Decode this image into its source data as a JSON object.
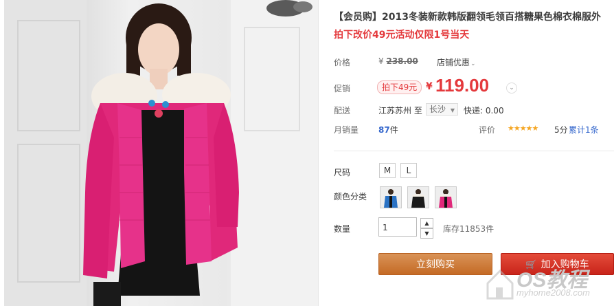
{
  "product": {
    "title": "【会员购】2013冬装新款韩版翻领毛领百搭糖果色棉衣棉服外",
    "subtitle": "拍下改价49元活动仅限1号当天"
  },
  "price": {
    "label": "价格",
    "currency": "¥",
    "original": "238.00",
    "shop_discount": "店铺优惠"
  },
  "promo": {
    "label": "促销",
    "tag": "拍下49元",
    "currency": "¥",
    "price": "119.00"
  },
  "shipping": {
    "label": "配送",
    "from": "江苏苏州 至",
    "to": "长沙",
    "fee": "快递: 0.00"
  },
  "sales": {
    "label": "月销量",
    "count": "87",
    "unit": "件",
    "rating_label": "评价",
    "stars": "★★★★★",
    "score": "5分",
    "review_count": "累计1条"
  },
  "size": {
    "label": "尺码",
    "options": [
      "M",
      "L"
    ]
  },
  "color": {
    "label": "颜色分类",
    "options": [
      {
        "name": "blue",
        "hex": "#2a72c4"
      },
      {
        "name": "black",
        "hex": "#1a1a1a"
      },
      {
        "name": "rose",
        "hex": "#e0287a"
      }
    ]
  },
  "quantity": {
    "label": "数量",
    "value": "1",
    "stock": "库存11853件"
  },
  "actions": {
    "buy_now": "立刻购买",
    "add_to_cart": "加入购物车"
  },
  "watermark": {
    "text": "OS教程",
    "url": "myhome2008.com"
  },
  "colors": {
    "accent_red": "#e4393c",
    "buy_orange": "#c8732e",
    "cart_red": "#d8301f",
    "link_blue": "#3366cc",
    "jacket_pink": "#e0287a"
  }
}
